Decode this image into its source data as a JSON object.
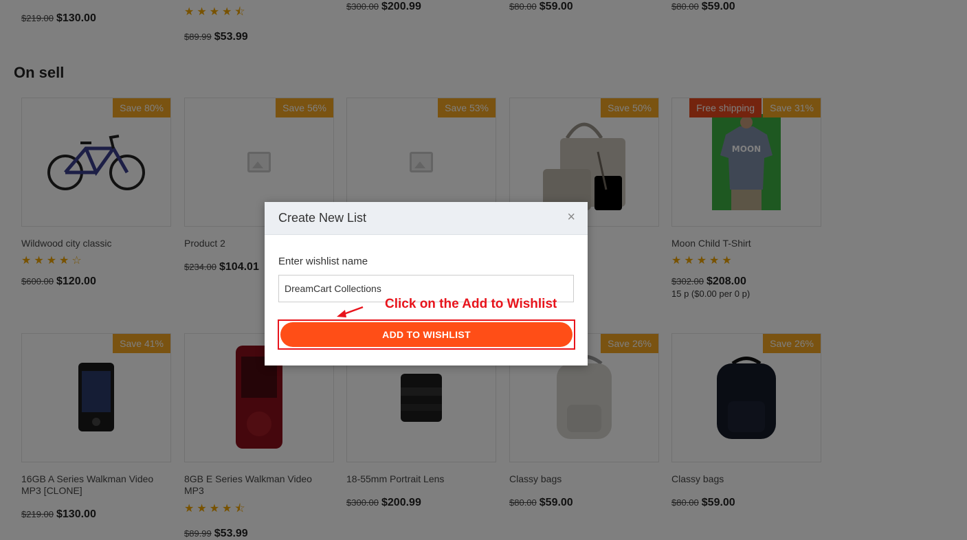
{
  "top_row": [
    {
      "old": "$219.00",
      "new": "$130.00"
    },
    {
      "old": "$89.99",
      "new": "$53.99",
      "stars": "★★★★⯪"
    },
    {
      "old": "$300.00",
      "new": "$200.99"
    },
    {
      "old": "$80.00",
      "new": "$59.00"
    },
    {
      "old": "$80.00",
      "new": "$59.00"
    }
  ],
  "section_title": "On sell",
  "row1": [
    {
      "badge": "Save 80%",
      "name": "Wildwood city classic",
      "stars": "★★★★☆",
      "old": "$600.00",
      "new": "$120.00",
      "image": "bicycle"
    },
    {
      "badge": "Save 56%",
      "name": "Product 2",
      "old": "$234.00",
      "new": "$104.01",
      "image": "placeholder-icon"
    },
    {
      "badge": "Save 53%",
      "image": "placeholder-icon"
    },
    {
      "badge": "Save 50%",
      "image": "handbag"
    },
    {
      "badge": "Save 31%",
      "badge2": "Free shipping",
      "name": "Moon Child T-Shirt",
      "stars": "★★★★★",
      "old": "$302.00",
      "new": "$208.00",
      "unit": "15 p ($0.00 per 0 p)",
      "image": "tshirt"
    }
  ],
  "row2": [
    {
      "badge": "Save 41%",
      "name": "16GB A Series Walkman Video MP3 [CLONE]",
      "old": "$219.00",
      "new": "$130.00",
      "image": "mp3-black"
    },
    {
      "name": "8GB E Series Walkman Video MP3",
      "stars": "★★★★⯪",
      "old": "$89.99",
      "new": "$53.99",
      "image": "mp3-red"
    },
    {
      "name": "18-55mm Portrait Lens",
      "old": "$300.00",
      "new": "$200.99",
      "image": "lens"
    },
    {
      "badge": "Save 26%",
      "name": "Classy bags",
      "old": "$80.00",
      "new": "$59.00",
      "image": "backpack-grey"
    },
    {
      "badge": "Save 26%",
      "name": "Classy bags",
      "old": "$80.00",
      "new": "$59.00",
      "image": "backpack-black"
    }
  ],
  "modal": {
    "title": "Create New List",
    "close_icon": "close-icon",
    "label": "Enter wishlist name",
    "input_value": "DreamCart Collections",
    "button_label": "ADD TO WISHLIST"
  },
  "annotation": "Click on the Add to Wishlist",
  "colors": {
    "accent": "#ff4e17",
    "badge": "#f5a623",
    "ship_badge": "#e8491d",
    "annotation": "#e8141c",
    "star": "#f0a500"
  }
}
